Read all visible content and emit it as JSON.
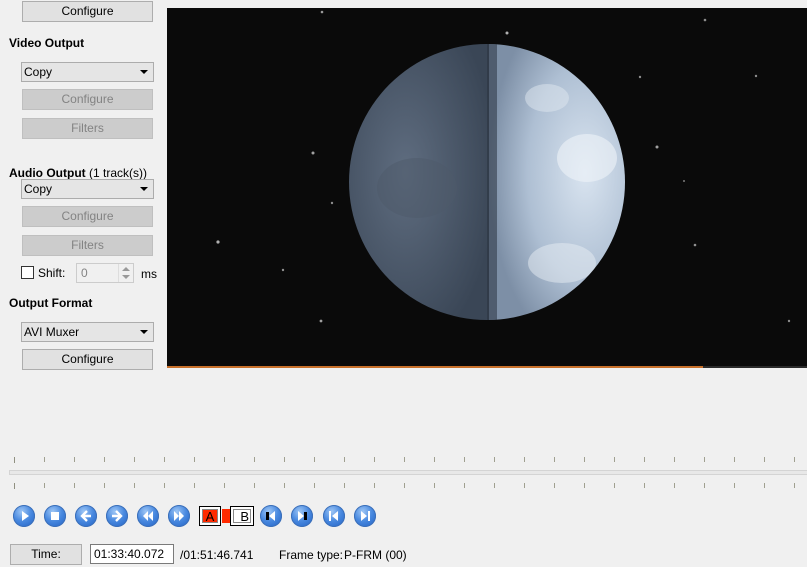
{
  "video_codec": {
    "configure_label": "Configure"
  },
  "video_output": {
    "heading": "Video Output",
    "selected": "Copy",
    "configure_label": "Configure",
    "filters_label": "Filters"
  },
  "audio_output": {
    "heading": "Audio Output",
    "track_info": "(1 track(s))",
    "selected": "Copy",
    "configure_label": "Configure",
    "filters_label": "Filters",
    "shift_label": "Shift:",
    "shift_checked": false,
    "shift_value": "0",
    "shift_unit": "ms"
  },
  "output_format": {
    "heading": "Output Format",
    "selected": "AVI Muxer",
    "configure_label": "Configure"
  },
  "preview": {
    "content": "Half-lit moon against a starry night sky",
    "progress_fraction": 0.838
  },
  "colors": {
    "progress": "#c8702a",
    "control_blue": "#4a8ae0",
    "marker_red": "#ff2a00"
  },
  "playback_controls": [
    {
      "name": "play-icon",
      "title": "Play"
    },
    {
      "name": "stop-icon",
      "title": "Stop"
    },
    {
      "name": "previous-frame-icon",
      "title": "Previous frame"
    },
    {
      "name": "next-frame-icon",
      "title": "Next frame"
    },
    {
      "name": "previous-keyframe-icon",
      "title": "Previous keyframe"
    },
    {
      "name": "next-keyframe-icon",
      "title": "Next keyframe"
    }
  ],
  "markers": {
    "a_label": "A",
    "b_label": "B"
  },
  "navigation_controls": [
    {
      "name": "go-to-marker-a-icon"
    },
    {
      "name": "go-to-marker-b-icon"
    },
    {
      "name": "go-to-first-frame-icon"
    },
    {
      "name": "go-to-last-frame-icon"
    }
  ],
  "status_bar": {
    "time_button_label": "Time:",
    "current_time": "01:33:40.072",
    "total_time": "/01:51:46.741",
    "frame_type_label": "Frame type:",
    "frame_type_value": "P-FRM (00)"
  }
}
